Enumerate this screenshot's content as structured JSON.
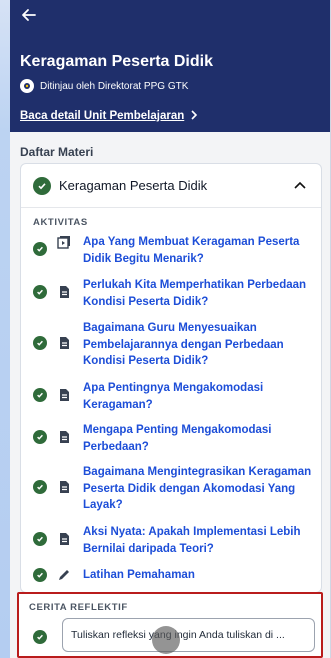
{
  "header": {
    "title": "Keragaman Peserta Didik",
    "reviewer": "Ditinjau oleh Direktorat PPG GTK",
    "detail_link": "Baca detail Unit Pembelajaran"
  },
  "materi": {
    "section_label": "Daftar Materi",
    "module_title": "Keragaman Peserta Didik",
    "aktivitas_label": "AKTIVITAS",
    "items": [
      {
        "type": "video-icon",
        "label": "Apa Yang Membuat Keragaman Peserta Didik Begitu Menarik?"
      },
      {
        "type": "document-icon",
        "label": "Perlukah Kita Memperhatikan Perbedaan Kondisi Peserta Didik?"
      },
      {
        "type": "document-icon",
        "label": "Bagaimana Guru Menyesuaikan Pembelajarannya dengan Perbedaan Kondisi Peserta Didik?"
      },
      {
        "type": "document-icon",
        "label": "Apa Pentingnya Mengakomodasi Keragaman?"
      },
      {
        "type": "document-icon",
        "label": "Mengapa Penting Mengakomodasi Perbedaan?"
      },
      {
        "type": "document-icon",
        "label": "Bagaimana Mengintegrasikan Keragaman Peserta Didik dengan Akomodasi Yang Layak?"
      },
      {
        "type": "document-icon",
        "label": "Aksi Nyata: Apakah Implementasi Lebih Bernilai daripada Teori?"
      },
      {
        "type": "pencil-icon",
        "label": "Latihan Pemahaman"
      }
    ]
  },
  "reflektif": {
    "label": "CERITA REFLEKTIF",
    "input_text": "Tuliskan refleksi yang ingin Anda tuliskan di ..."
  },
  "colors": {
    "header_bg": "#1f2f6b",
    "link_blue": "#1d4ed8",
    "check_green": "#2f6b3a",
    "highlight_red": "#b91c1c"
  }
}
